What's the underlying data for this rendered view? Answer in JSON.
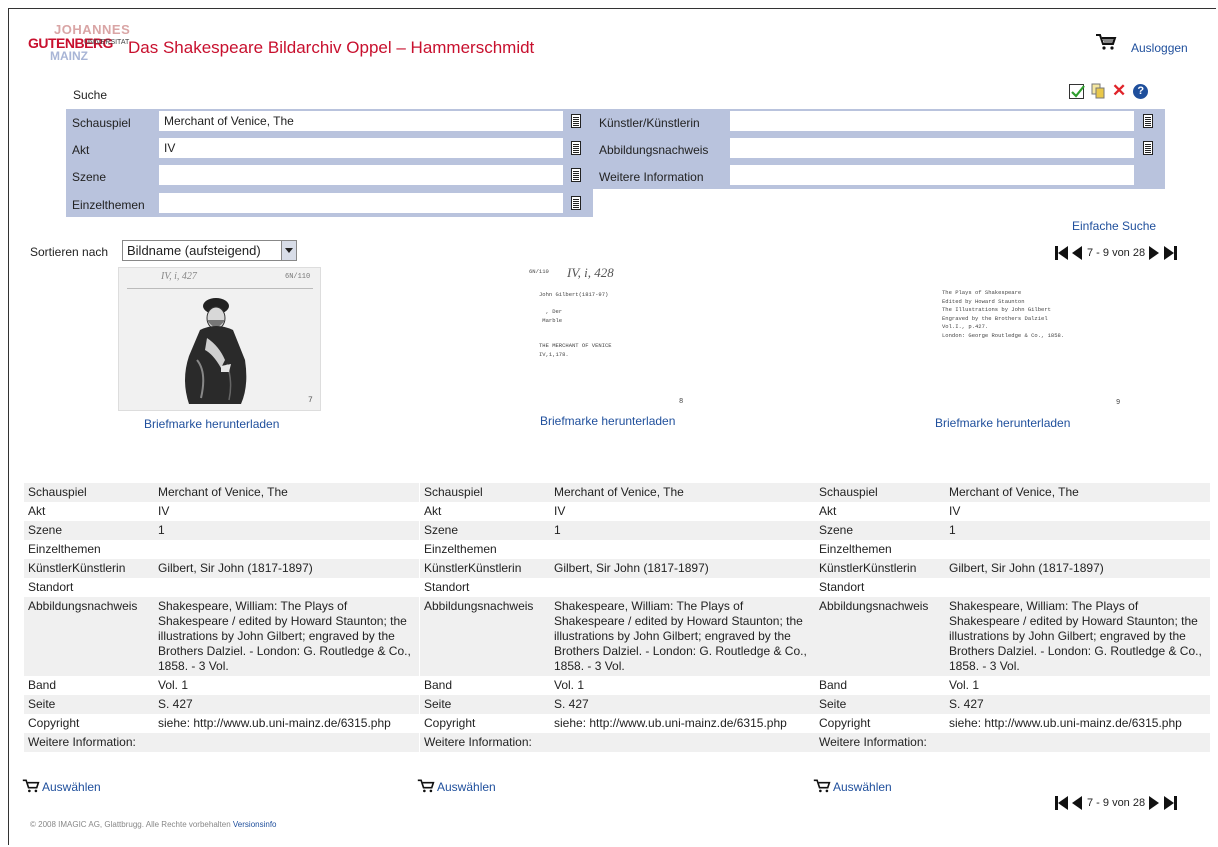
{
  "header": {
    "logo": {
      "line1": "JOHANNES",
      "line2": "GUTENBERG",
      "line3": "UNIVERSITAT",
      "line4": "MAINZ"
    },
    "title": "Das Shakespeare Bildarchiv Oppel – Hammerschmidt",
    "logout": "Ausloggen"
  },
  "search": {
    "title": "Suche",
    "fields_left": [
      {
        "label": "Schauspiel",
        "value": "Merchant of Venice, The"
      },
      {
        "label": "Akt",
        "value": "IV"
      },
      {
        "label": "Szene",
        "value": ""
      },
      {
        "label": "Einzelthemen",
        "value": ""
      }
    ],
    "fields_right": [
      {
        "label": "Künstler/Künstlerin",
        "value": ""
      },
      {
        "label": "Abbildungsnachweis",
        "value": ""
      },
      {
        "label": "Weitere Information",
        "value": ""
      }
    ],
    "simple_search": "Einfache Suche"
  },
  "sort": {
    "label": "Sortieren nach",
    "selected": "Bildname (aufsteigend)"
  },
  "pager": {
    "text": "7 - 9 von 28"
  },
  "thumbs": [
    {
      "hand": "IV, i, 427",
      "num": "6N/110",
      "corner": "7",
      "download": "Briefmarke herunterladen"
    },
    {
      "num": "6N/110",
      "hand": "IV, i, 428",
      "lines": "John Gilbert(1817-97)\n\n  , Der\n Marble\n\n\nTHE MERCHANT OF VENICE\nIV,1,178.",
      "corner": "8",
      "download": "Briefmarke herunterladen"
    },
    {
      "lines": "The Plays of Shakespeare\nEdited by Howard Staunton\nThe Illustrations by John Gilbert\nEngraved by the Brothers Dalziel\nVol.I., p.427.\nLondon: George Routledge & Co., 1858.",
      "corner": "9",
      "download": "Briefmarke herunterladen"
    }
  ],
  "details": [
    {
      "rows": [
        {
          "k": "Schauspiel",
          "v": "Merchant of Venice, The"
        },
        {
          "k": "Akt",
          "v": "IV"
        },
        {
          "k": "Szene",
          "v": "1"
        },
        {
          "k": "Einzelthemen",
          "v": ""
        },
        {
          "k": "KünstlerKünstlerin",
          "v": "Gilbert, Sir John (1817-1897)"
        },
        {
          "k": "Standort",
          "v": ""
        },
        {
          "k": "Abbildungsnachweis",
          "v": "Shakespeare, William: The Plays of Shakespeare / edited by Howard Staunton; the illustrations by John Gilbert; engraved by the Brothers Dalziel. - London: G. Routledge & Co., 1858. - 3 Vol."
        },
        {
          "k": "Band",
          "v": "Vol. 1"
        },
        {
          "k": "Seite",
          "v": "S. 427"
        },
        {
          "k": "Copyright",
          "v": "siehe: http://www.ub.uni-mainz.de/6315.php"
        },
        {
          "k": "Weitere Information:",
          "v": ""
        }
      ],
      "select": "Auswählen"
    },
    {
      "rows": [
        {
          "k": "Schauspiel",
          "v": "Merchant of Venice, The"
        },
        {
          "k": "Akt",
          "v": "IV"
        },
        {
          "k": "Szene",
          "v": "1"
        },
        {
          "k": "Einzelthemen",
          "v": ""
        },
        {
          "k": "KünstlerKünstlerin",
          "v": "Gilbert, Sir John (1817-1897)"
        },
        {
          "k": "Standort",
          "v": ""
        },
        {
          "k": "Abbildungsnachweis",
          "v": "Shakespeare, William: The Plays of Shakespeare / edited by Howard Staunton; the illustrations by John Gilbert; engraved by the Brothers Dalziel. - London: G. Routledge & Co., 1858. - 3 Vol."
        },
        {
          "k": "Band",
          "v": "Vol. 1"
        },
        {
          "k": "Seite",
          "v": "S. 427"
        },
        {
          "k": "Copyright",
          "v": "siehe: http://www.ub.uni-mainz.de/6315.php"
        },
        {
          "k": "Weitere Information:",
          "v": ""
        }
      ],
      "select": "Auswählen"
    },
    {
      "rows": [
        {
          "k": "Schauspiel",
          "v": "Merchant of Venice, The"
        },
        {
          "k": "Akt",
          "v": "IV"
        },
        {
          "k": "Szene",
          "v": "1"
        },
        {
          "k": "Einzelthemen",
          "v": ""
        },
        {
          "k": "KünstlerKünstlerin",
          "v": "Gilbert, Sir John (1817-1897)"
        },
        {
          "k": "Standort",
          "v": ""
        },
        {
          "k": "Abbildungsnachweis",
          "v": "Shakespeare, William: The Plays of Shakespeare / edited by Howard Staunton; the illustrations by John Gilbert; engraved by the Brothers Dalziel. - London: G. Routledge & Co., 1858. - 3 Vol."
        },
        {
          "k": "Band",
          "v": "Vol. 1"
        },
        {
          "k": "Seite",
          "v": "S. 427"
        },
        {
          "k": "Copyright",
          "v": "siehe: http://www.ub.uni-mainz.de/6315.php"
        },
        {
          "k": "Weitere Information:",
          "v": ""
        }
      ],
      "select": "Auswählen"
    }
  ],
  "footer": {
    "text": "© 2008 IMAGIC AG, Glattbrugg. Alle Rechte vorbehalten",
    "version_link": "Versionsinfo"
  },
  "icons": [
    "cart-icon",
    "check-icon",
    "copy-icon",
    "close-icon",
    "help-icon",
    "list-icon",
    "first-page-icon",
    "prev-page-icon",
    "next-page-icon",
    "last-page-icon"
  ],
  "colors": {
    "brand_red": "#c8102e",
    "link_blue": "#1f4f9c",
    "form_bg": "#b9c3dd",
    "row_alt": "#f0f0f0"
  }
}
